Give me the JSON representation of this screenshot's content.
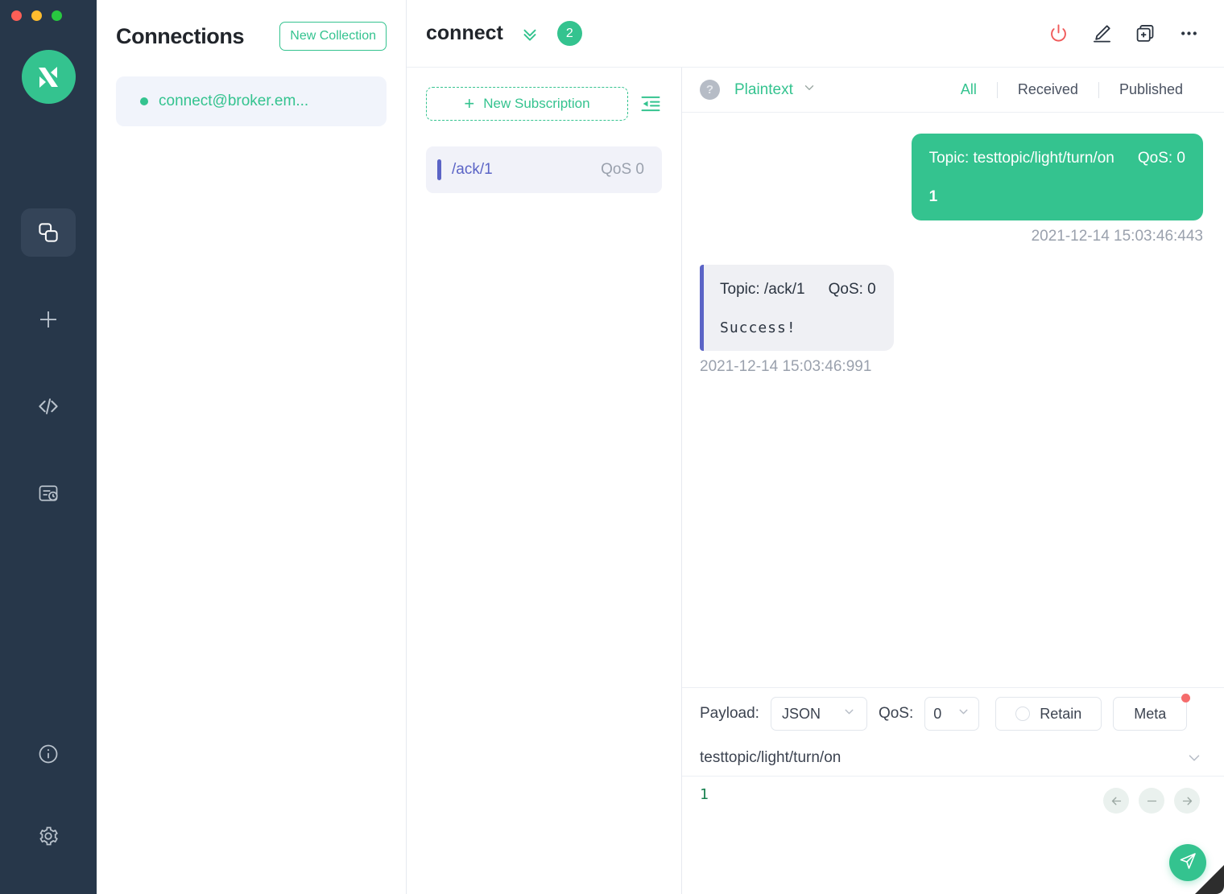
{
  "window": {
    "traffic_lights": [
      "close",
      "minimize",
      "zoom"
    ],
    "logo_name": "mqttx-logo"
  },
  "rail": {
    "items": [
      {
        "name": "connections",
        "icon": "connections-icon",
        "active": true
      },
      {
        "name": "new-connection",
        "icon": "plus-icon",
        "active": false
      },
      {
        "name": "scripts",
        "icon": "code-icon",
        "active": false
      },
      {
        "name": "log",
        "icon": "log-icon",
        "active": false
      }
    ],
    "bottom_items": [
      {
        "name": "about",
        "icon": "info-icon"
      },
      {
        "name": "settings",
        "icon": "gear-icon"
      }
    ]
  },
  "connections": {
    "title": "Connections",
    "new_collection_label": "New Collection",
    "items": [
      {
        "label": "connect@broker.em...",
        "status": "connected",
        "selected": true
      }
    ]
  },
  "topbar": {
    "title": "connect",
    "chevron_icon": "chevron-double-down-icon",
    "badge": "2",
    "actions": [
      {
        "name": "disconnect-button",
        "icon": "power-icon"
      },
      {
        "name": "edit-connection-button",
        "icon": "pencil-icon"
      },
      {
        "name": "new-window-button",
        "icon": "new-tab-icon"
      },
      {
        "name": "more-menu-button",
        "icon": "ellipsis-icon"
      }
    ]
  },
  "subscriptions": {
    "new_subscription_label": "New Subscription",
    "collapse_icon": "collapse-left-icon",
    "items": [
      {
        "topic": "/ack/1",
        "qos": "QoS 0",
        "color": "#5b64c6"
      }
    ]
  },
  "message_bar": {
    "help_icon_label": "?",
    "format": "Plaintext",
    "format_chevron": "chevron-down-icon",
    "filters": [
      {
        "label": "All",
        "active": true
      },
      {
        "label": "Received",
        "active": false
      },
      {
        "label": "Published",
        "active": false
      }
    ]
  },
  "messages": [
    {
      "direction": "published",
      "topic_label": "Topic: testtopic/light/turn/on",
      "qos_label": "QoS: 0",
      "payload": "1",
      "time": "2021-12-14 15:03:46:443"
    },
    {
      "direction": "received",
      "topic_label": "Topic: /ack/1",
      "qos_label": "QoS: 0",
      "payload": "Success!",
      "time": "2021-12-14 15:03:46:991"
    }
  ],
  "publish": {
    "payload_label": "Payload:",
    "payload_format": "JSON",
    "qos_label": "QoS:",
    "qos_value": "0",
    "retain_label": "Retain",
    "retain_checked": false,
    "meta_label": "Meta",
    "meta_has_badge": true,
    "topic": "testtopic/light/turn/on",
    "topic_chevron": "chevron-down-icon",
    "editor_content": "1",
    "editor_tools": [
      {
        "name": "prev-button",
        "icon": "arrow-left-icon"
      },
      {
        "name": "collapse-button",
        "icon": "minus-icon"
      },
      {
        "name": "next-button",
        "icon": "arrow-right-icon"
      }
    ],
    "send_icon": "send-icon"
  },
  "colors": {
    "accent_green": "#34c38f",
    "rail_dark": "#27374a",
    "subscription_purple": "#5b64c6",
    "power_red": "#f05a5a",
    "badge_red": "#f56c6c"
  }
}
